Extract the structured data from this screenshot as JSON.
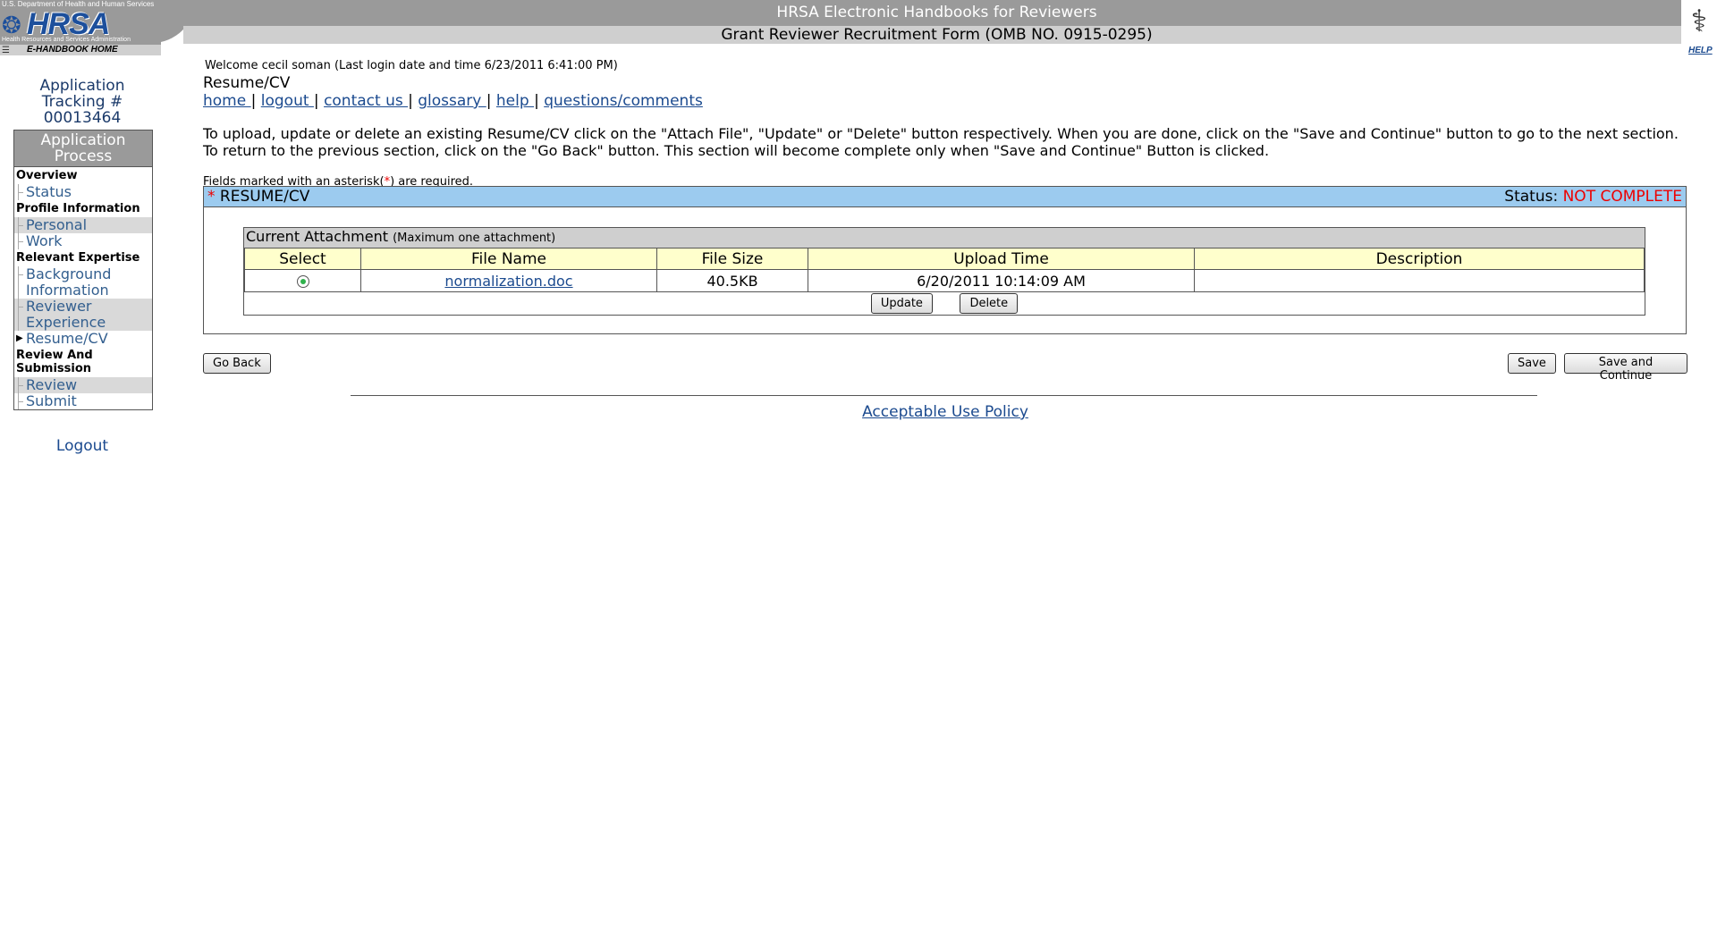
{
  "header": {
    "hhs_text": "U.S. Department of Health and Human Services",
    "logo_text": "HRSA",
    "logo_subtext": "Health Resources and Services Administration",
    "ehb_home": "E-HANDBOOK HOME",
    "app_title": "HRSA Electronic Handbooks for Reviewers",
    "form_title": "Grant Reviewer Recruitment Form (OMB NO. 0915-0295)",
    "help": "HELP"
  },
  "sidebar": {
    "tracking_line1": "Application",
    "tracking_line2": "Tracking #",
    "tracking_number": "00013464",
    "nav_heading_line1": "Application",
    "nav_heading_line2": "Process",
    "sections": {
      "overview": "Overview",
      "profile": "Profile Information",
      "expertise": "Relevant Expertise",
      "review_line1": "Review And",
      "review_line2": "Submission"
    },
    "items": {
      "status": "Status",
      "personal": "Personal",
      "work": "Work",
      "background_line1": "Background",
      "background_line2": "Information",
      "reviewer_line1": "Reviewer",
      "reviewer_line2": "Experience",
      "resume": "Resume/CV",
      "review": "Review",
      "submit": "Submit"
    },
    "logout": "Logout"
  },
  "main": {
    "welcome": "Welcome cecil soman (Last login date and time 6/23/2011 6:41:00 PM)",
    "heading": "Resume/CV",
    "links": {
      "home": "home ",
      "logout": "logout ",
      "contact": "contact us ",
      "glossary": "glossary ",
      "help": "help ",
      "questions": "questions/comments",
      "sep": "|"
    },
    "instructions": "To upload, update or delete an existing Resume/CV click on the \"Attach File\", \"Update\" or \"Delete\" button respectively. When you are done, click on the \"Save and Continue\" button to go to the next section. To return to the previous section, click on the \"Go Back\" button. This section will become complete only when \"Save and Continue\" Button is clicked.",
    "required_prefix": "Fields marked with an asterisk(",
    "required_ast": "*",
    "required_suffix": ") are required.",
    "section": {
      "asterisk": "*",
      "title": " RESUME/CV",
      "status_label": "Status: ",
      "status_value": "NOT COMPLETE"
    },
    "attachment": {
      "heading": "Current Attachment ",
      "note": "(Maximum one attachment)",
      "columns": [
        "Select",
        "File Name",
        "File Size",
        "Upload Time",
        "Description"
      ],
      "row": {
        "file_name": "normalization.doc",
        "file_size": "40.5KB",
        "upload_time": "6/20/2011 10:14:09 AM",
        "description": ""
      },
      "update": "Update",
      "delete": "Delete"
    },
    "buttons": {
      "go_back": "Go Back",
      "save": "Save",
      "save_continue": "Save and Continue"
    },
    "footer_link": "Acceptable Use Policy"
  }
}
